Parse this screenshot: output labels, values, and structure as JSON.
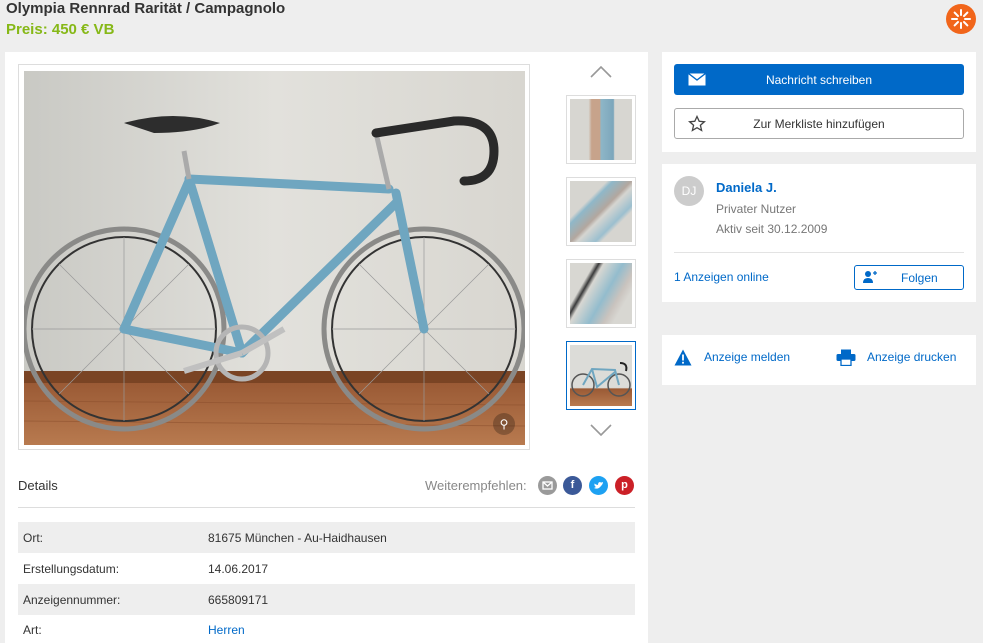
{
  "header": {
    "title": "Olympia Rennrad Rarität / Campagnolo",
    "price": "Preis: 450 € VB"
  },
  "gallery": {
    "thumbnails": [
      "thumb-1",
      "thumb-2",
      "thumb-3",
      "thumb-4"
    ],
    "active_thumbnail": 4
  },
  "details": {
    "label": "Details",
    "share_label": "Weiterempfehlen:",
    "share_icons": [
      "email-icon",
      "facebook-icon",
      "twitter-icon",
      "pinterest-icon"
    ],
    "rows": [
      {
        "key": "Ort:",
        "value": "81675 München - Au-Haidhausen"
      },
      {
        "key": "Erstellungsdatum:",
        "value": "14.06.2017"
      },
      {
        "key": "Anzeigennummer:",
        "value": "665809171"
      },
      {
        "key": "Art:",
        "value": "Herren"
      }
    ]
  },
  "actions": {
    "message_label": "Nachricht schreiben",
    "watchlist_label": "Zur Merkliste hinzufügen"
  },
  "seller": {
    "initials": "DJ",
    "name": "Daniela J.",
    "type": "Privater Nutzer",
    "since": "Aktiv seit 30.12.2009",
    "online_ads": "1 Anzeigen online",
    "follow_label": "Folgen"
  },
  "report": {
    "report_label": "Anzeige melden",
    "print_label": "Anzeige drucken"
  },
  "colors": {
    "accent": "#0069c8",
    "price": "#86b817",
    "logo": "#f1651a"
  }
}
